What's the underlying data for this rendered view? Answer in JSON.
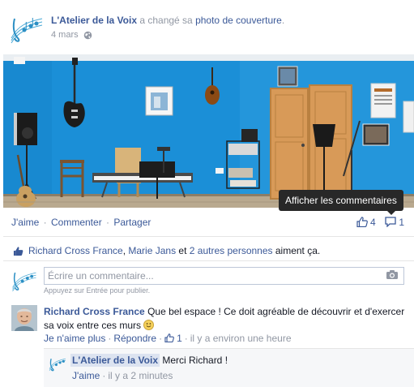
{
  "post": {
    "page_name": "L'Atelier de la Voix",
    "action_text": "a changé sa",
    "action_link": "photo de couverture",
    "action_end": ".",
    "date": "4 mars"
  },
  "actions": {
    "like": "J'aime",
    "comment": "Commenter",
    "share": "Partager",
    "separator": "·",
    "like_count": "4",
    "comment_count": "1"
  },
  "tooltip": "Afficher les commentaires",
  "likes": {
    "person1": "Richard Cross France",
    "comma": ",",
    "person2": "Marie Jans",
    "and": "et",
    "others": "2 autres personnes",
    "suffix": "aiment ça."
  },
  "composer": {
    "placeholder": "Écrire un commentaire...",
    "hint": "Appuyez sur Entrée pour publier."
  },
  "comments": [
    {
      "author": "Richard Cross France",
      "text": "Que bel espace ! Ce doit agréable de découvrir et d'exercer sa voix entre ces murs",
      "unlike": "Je n'aime plus",
      "reply": "Répondre",
      "likes": "1",
      "time": "il y a environ une heure"
    }
  ],
  "reply": {
    "author": "L'Atelier de la Voix",
    "text": "Merci Richard !",
    "like": "J'aime",
    "time": "il y a 2 minutes"
  },
  "colors": {
    "link": "#3b5998",
    "muted": "#9197a3",
    "wall_blue": "#1a8fd6",
    "tooltip_bg": "#282828"
  }
}
